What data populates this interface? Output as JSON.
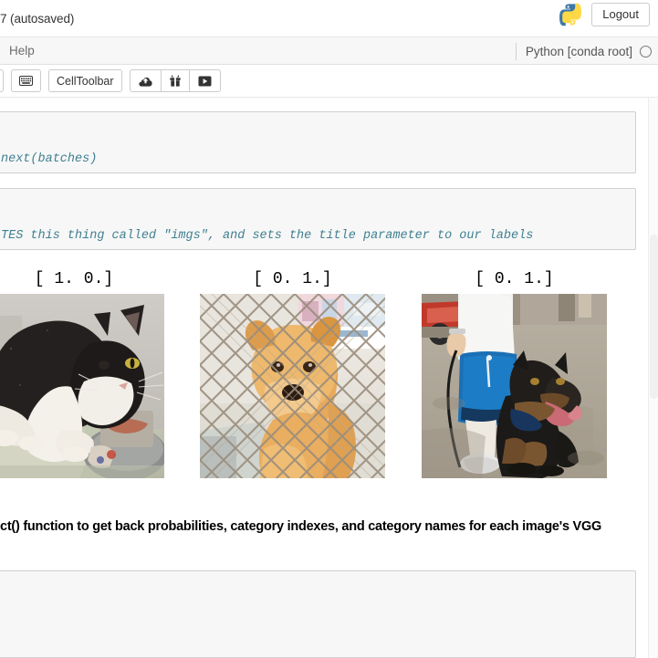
{
  "header": {
    "notebook_title": "7 (autosaved)",
    "logout_label": "Logout",
    "python_logo_icon": "python-logo-icon"
  },
  "menubar": {
    "items": [
      {
        "label": "Help",
        "name": "menu-item-help"
      }
    ],
    "kernel_name": "Python [conda root]",
    "kernel_indicator_icon": "kernel-idle-circle-icon"
  },
  "toolbar": {
    "keyboard_button_icon": "keyboard-icon",
    "celltoolbar_label": "CellToolbar",
    "cloud_upload_icon": "cloud-upload-icon",
    "gift_icon": "gift-icon",
    "play_video_icon": "play-video-icon"
  },
  "notebook": {
    "cells": [
      {
        "type": "code",
        "name": "code-cell-1",
        "source": "next(batches)"
      },
      {
        "type": "code",
        "name": "code-cell-2",
        "source": "TES this thing called \"imgs\", and sets the title parameter to our labels"
      },
      {
        "type": "markdown",
        "name": "markdown-cell",
        "text": "ct() function to get back probabilities, category indexes, and category names for each image's VGG"
      },
      {
        "type": "code",
        "name": "code-cell-empty",
        "source": ""
      }
    ],
    "image_output": {
      "figures": [
        {
          "name": "figure-cat",
          "title": "[ 1. 0.]",
          "subject": "tuxedo-cat-photo"
        },
        {
          "name": "figure-golden-dog",
          "title": "[ 0. 1.]",
          "subject": "golden-dog-behind-fence-photo"
        },
        {
          "name": "figure-rottweiler",
          "title": "[ 0. 1.]",
          "subject": "rottweiler-with-person-photo"
        }
      ]
    }
  },
  "colors": {
    "code_text": "#408090",
    "cell_background": "#f7f7f7",
    "cell_border": "#cfcfcf",
    "menubar_background": "#f7f7f7",
    "python_blue": "#3c78a8",
    "python_yellow": "#ffd845"
  }
}
